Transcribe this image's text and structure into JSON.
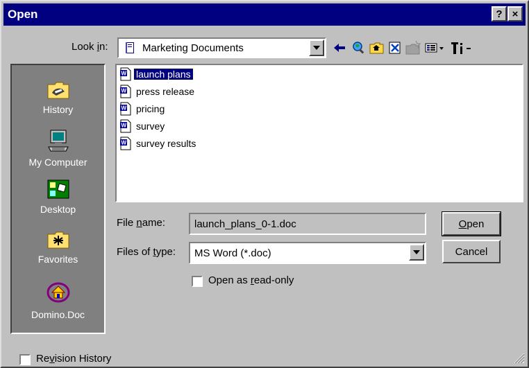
{
  "window": {
    "title": "Open",
    "help_label": "?",
    "close_label": "×"
  },
  "lookin": {
    "label_prefix": "Look ",
    "label_accel": "i",
    "label_suffix": "n:",
    "value": "Marketing Documents"
  },
  "places": [
    {
      "label": "History",
      "icon": "history-folder-icon"
    },
    {
      "label": "My Computer",
      "icon": "computer-icon"
    },
    {
      "label": "Desktop",
      "icon": "desktop-icon"
    },
    {
      "label": "Favorites",
      "icon": "favorites-folder-icon"
    },
    {
      "label": "Domino.Doc",
      "icon": "domino-doc-icon"
    }
  ],
  "files": [
    {
      "name": "launch plans",
      "selected": true
    },
    {
      "name": "press release",
      "selected": false
    },
    {
      "name": "pricing",
      "selected": false
    },
    {
      "name": "survey",
      "selected": false
    },
    {
      "name": "survey results",
      "selected": false
    }
  ],
  "filename": {
    "label_prefix": "File ",
    "label_accel": "n",
    "label_suffix": "ame:",
    "value": "launch_plans_0-1.doc"
  },
  "filetype": {
    "label_prefix": "Files of ",
    "label_accel": "t",
    "label_suffix": "ype:",
    "value": "MS Word (*.doc)"
  },
  "readonly": {
    "label_prefix": "Open as ",
    "label_accel": "r",
    "label_suffix": "ead-only"
  },
  "buttons": {
    "open_accel": "O",
    "open_rest": "pen",
    "cancel": "Cancel"
  },
  "revision": {
    "label_prefix": "Re",
    "label_accel": "v",
    "label_suffix": "ision History"
  },
  "colors": {
    "titlebar": "#000080",
    "face": "#c0c0c0",
    "places_bg": "#808080",
    "selection": "#000080"
  }
}
